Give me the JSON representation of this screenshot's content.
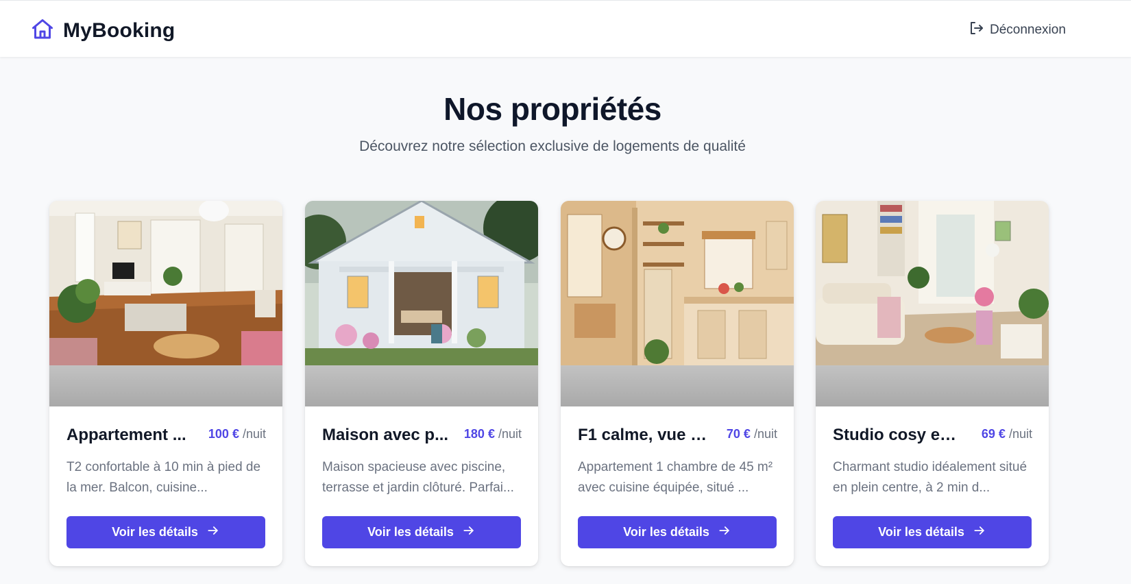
{
  "header": {
    "brand": "MyBooking",
    "brand_icon": "house-icon",
    "logout_label": "Déconnexion",
    "logout_icon": "logout-icon"
  },
  "hero": {
    "title": "Nos propriétés",
    "subtitle": "Découvrez notre sélection exclusive de logements de qualité"
  },
  "colors": {
    "accent": "#4f46e5",
    "background": "#f8f9fb"
  },
  "properties": [
    {
      "title": "Appartement ...",
      "price": "100 €",
      "unit": "/nuit",
      "description": "T2 confortable à 10 min à pied de la mer. Balcon, cuisine...",
      "button": "Voir les détails",
      "button_icon": "arrow-right-icon"
    },
    {
      "title": "Maison avec p...",
      "price": "180 €",
      "unit": "/nuit",
      "description": "Maison spacieuse avec piscine, terrasse et jardin clôturé. Parfai...",
      "button": "Voir les détails",
      "button_icon": "arrow-right-icon"
    },
    {
      "title": "F1 calme, vue d...",
      "price": "70 €",
      "unit": "/nuit",
      "description": "Appartement 1 chambre de 45 m² avec cuisine équipée, situé ...",
      "button": "Voir les détails",
      "button_icon": "arrow-right-icon"
    },
    {
      "title": "Studio cosy en ...",
      "price": "69 €",
      "unit": "/nuit",
      "description": "Charmant studio idéalement situé en plein centre, à 2 min d...",
      "button": "Voir les détails",
      "button_icon": "arrow-right-icon"
    }
  ]
}
